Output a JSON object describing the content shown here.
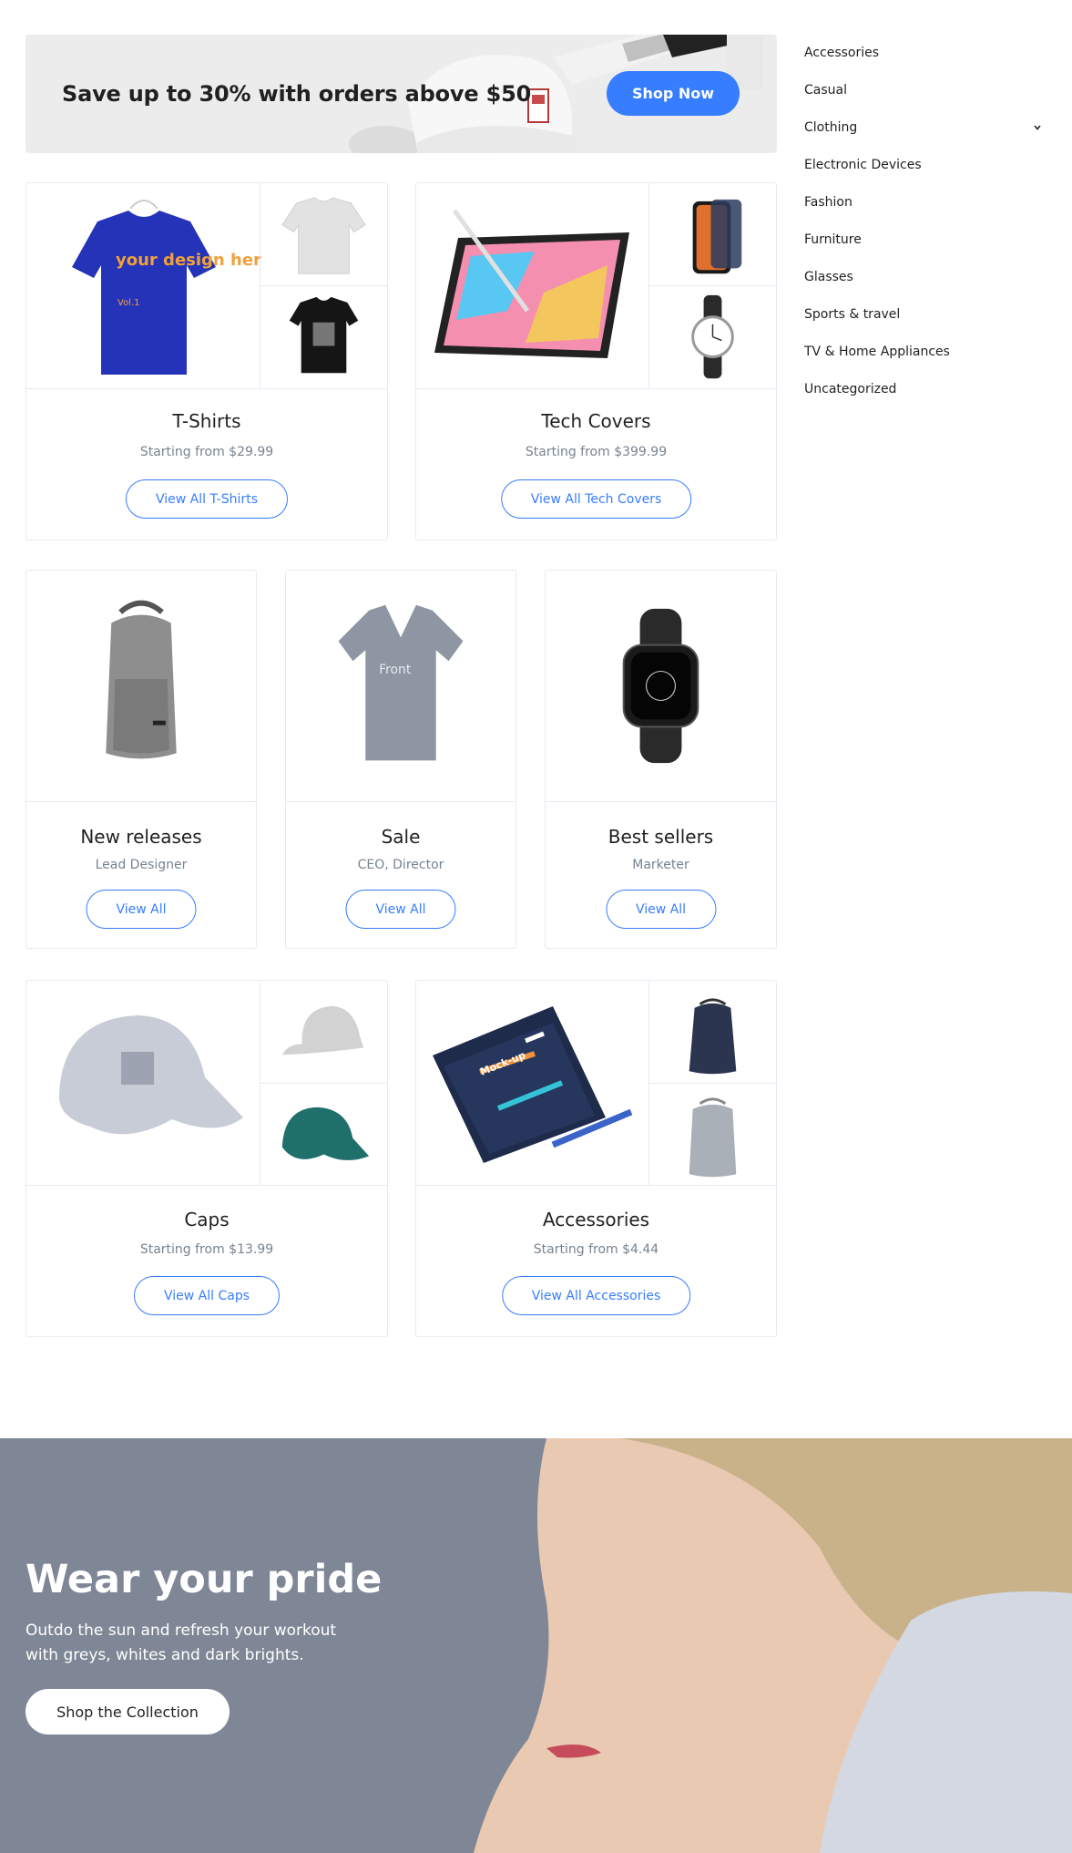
{
  "promo": {
    "text": "Save up to 30% with orders above $50",
    "button": "Shop Now"
  },
  "sidebar": {
    "items": [
      {
        "label": "Accessories"
      },
      {
        "label": "Casual"
      },
      {
        "label": "Clothing",
        "icon": "chevron-down-icon"
      },
      {
        "label": "Electronic Devices"
      },
      {
        "label": "Fashion"
      },
      {
        "label": "Furniture"
      },
      {
        "label": "Glasses"
      },
      {
        "label": "Sports & travel"
      },
      {
        "label": "TV & Home Appliances"
      },
      {
        "label": "Uncategorized"
      }
    ]
  },
  "cards": {
    "tshirts": {
      "title": "T-Shirts",
      "subtitle": "Starting from $29.99",
      "button": "View All T-Shirts",
      "art_text": "your design here",
      "art_sub": "Vol.1"
    },
    "tech": {
      "title": "Tech Covers",
      "subtitle": "Starting from $399.99",
      "button": "View All Tech Covers"
    },
    "new": {
      "title": "New releases",
      "subtitle": "Lead Designer",
      "button": "View All"
    },
    "sale": {
      "title": "Sale",
      "subtitle": "CEO, Director",
      "button": "View All",
      "art_text": "Front"
    },
    "best": {
      "title": "Best sellers",
      "subtitle": "Marketer",
      "button": "View All"
    },
    "caps": {
      "title": "Caps",
      "subtitle": "Starting from $13.99",
      "button": "View All Caps"
    },
    "accessories": {
      "title": "Accessories",
      "subtitle": "Starting from $4.44",
      "button": "View All Accessories",
      "art_text": "Mock-up"
    }
  },
  "hero": {
    "title": "Wear your pride",
    "subtitle": "Outdo the sun and refresh your workout with greys, whites and dark brights.",
    "button": "Shop the Collection"
  },
  "colors": {
    "accent": "#377dff",
    "text": "#1e2022",
    "muted": "#77838f",
    "border": "#e7eaf3"
  }
}
